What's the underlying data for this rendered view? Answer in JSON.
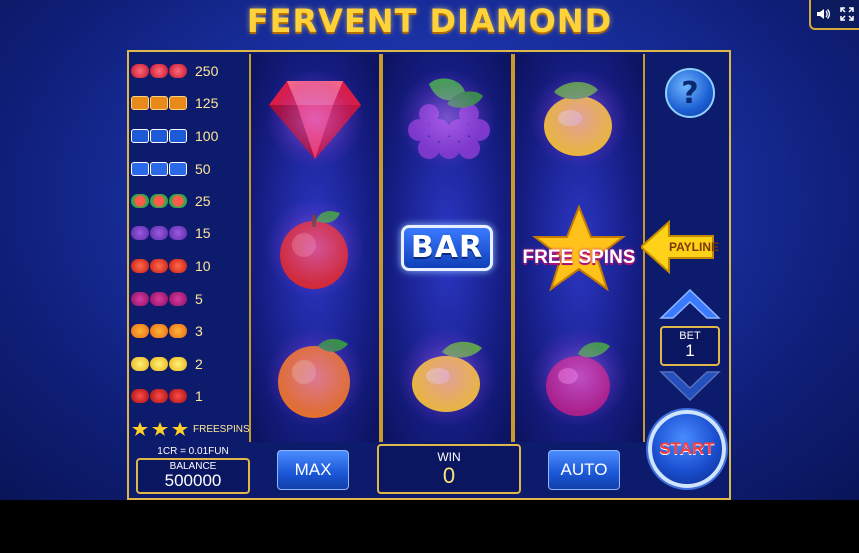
{
  "game": {
    "title": "FERVENT DIAMOND"
  },
  "top_controls": {
    "icons": [
      "speaker-icon",
      "fullscreen-icon"
    ]
  },
  "paytable": [
    {
      "symbol": "diamond",
      "value": "250"
    },
    {
      "symbol": "bar-orange",
      "value": "125"
    },
    {
      "symbol": "bar-blue-double",
      "value": "100"
    },
    {
      "symbol": "bar-blue",
      "value": "50"
    },
    {
      "symbol": "melon",
      "value": "25"
    },
    {
      "symbol": "grapes",
      "value": "15"
    },
    {
      "symbol": "apple",
      "value": "10"
    },
    {
      "symbol": "plum",
      "value": "5"
    },
    {
      "symbol": "orange",
      "value": "3"
    },
    {
      "symbol": "lemon",
      "value": "2"
    },
    {
      "symbol": "cherry",
      "value": "1"
    },
    {
      "symbol": "star",
      "value": "FREESPINS"
    }
  ],
  "reels": [
    [
      "diamond",
      "apple",
      "orange"
    ],
    [
      "grapes",
      "bar",
      "lemon"
    ],
    [
      "lemon",
      "free-spins-star",
      "plum"
    ]
  ],
  "symbol_text": {
    "bar": "BAR",
    "free_spins": "FREE SPINS"
  },
  "payline_label": "PAYLINE",
  "help_label": "?",
  "bet": {
    "label": "BET",
    "value": "1"
  },
  "start_label": "START",
  "credit_note": "1CR = 0.01FUN",
  "balance": {
    "label": "BALANCE",
    "value": "500000"
  },
  "max_label": "MAX",
  "win": {
    "label": "WIN",
    "value": "0"
  },
  "auto_label": "AUTO",
  "colors": {
    "frame_gold": "#e0b84a",
    "title_gold": "#ffd23a",
    "bg_blue": "#1b33a8",
    "start_red": "#ff3b3b"
  }
}
